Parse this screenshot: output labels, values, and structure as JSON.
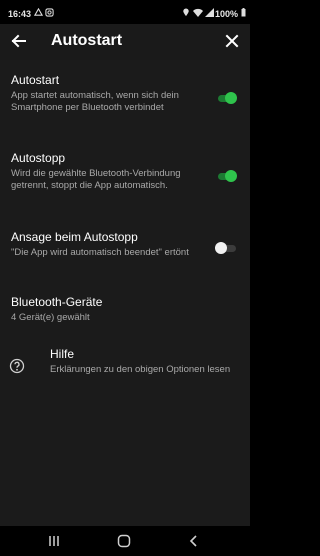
{
  "status": {
    "time": "16:43",
    "battery": "100%"
  },
  "appbar": {
    "title": "Autostart"
  },
  "settings": [
    {
      "title": "Autostart",
      "subtitle": "App startet automatisch, wenn sich dein Smartphone per Bluetooth verbindet",
      "toggle": true
    },
    {
      "title": "Autostopp",
      "subtitle": "Wird die gewählte Bluetooth-Verbindung getrennt, stoppt die App automatisch.",
      "toggle": true
    },
    {
      "title": "Ansage beim Autostopp",
      "subtitle": "\"Die App wird automatisch beendet\" ertönt",
      "toggle": false
    },
    {
      "title": "Bluetooth-Geräte",
      "subtitle": "4 Gerät(e) gewählt"
    },
    {
      "title": "Hilfe",
      "subtitle": "Erklärungen zu den obigen Optionen lesen"
    }
  ],
  "colors": {
    "accent": "#2fc34c",
    "background": "#1b1b1b",
    "appbar": "#1a1a1a"
  },
  "icons": {
    "back": "arrow-left-icon",
    "close": "close-icon",
    "help": "question-circle-icon"
  }
}
